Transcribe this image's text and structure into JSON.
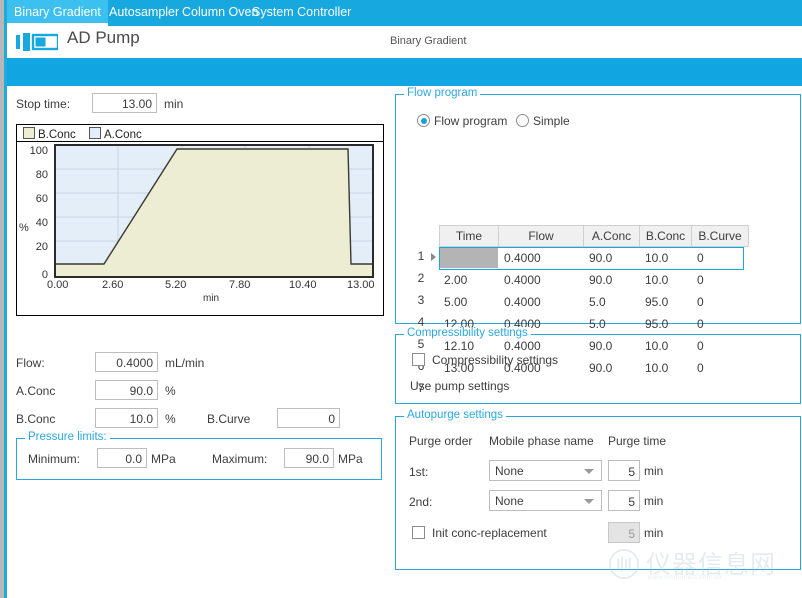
{
  "tabs": [
    {
      "label": "Binary Gradient",
      "active": true
    },
    {
      "label": "Autosampler",
      "active": false
    },
    {
      "label": "Column Oven",
      "active": false
    },
    {
      "label": "System Controller",
      "active": false
    }
  ],
  "header": {
    "title": "AD Pump",
    "mode": "Binary Gradient",
    "icon": "pump-icon"
  },
  "left": {
    "stop_time_label": "Stop time:",
    "stop_time_value": "13.00",
    "stop_time_unit": "min",
    "collapse_icon": "chevron-double-up-icon",
    "flow_label": "Flow:",
    "flow_value": "0.4000",
    "flow_unit": "mL/min",
    "aconc_label": "A.Conc",
    "aconc_value": "90.0",
    "aconc_unit": "%",
    "bconc_label": "B.Conc",
    "bconc_value": "10.0",
    "bconc_unit": "%",
    "bcurve_label": "B.Curve",
    "bcurve_value": "0",
    "pressure": {
      "group_title": "Pressure limits:",
      "min_label": "Minimum:",
      "min_value": "0.0",
      "min_unit": "MPa",
      "max_label": "Maximum:",
      "max_value": "90.0",
      "max_unit": "MPa"
    }
  },
  "chart_data": {
    "type": "area",
    "title": "",
    "xlabel": "min",
    "ylabel": "%",
    "xlim": [
      0,
      13
    ],
    "ylim": [
      0,
      105
    ],
    "xticks": [
      "0.00",
      "2.60",
      "5.20",
      "7.80",
      "10.40",
      "13.00"
    ],
    "xtick_values": [
      0,
      2.6,
      5.2,
      7.8,
      10.4,
      13.0
    ],
    "yticks": [
      "0",
      "20",
      "40",
      "60",
      "80",
      "100"
    ],
    "ytick_values": [
      0,
      20,
      40,
      60,
      80,
      100
    ],
    "grid": true,
    "legend_position": "top-left",
    "series": [
      {
        "name": "B.Conc",
        "color": "#ecedd2",
        "x": [
          0.0,
          2.0,
          5.0,
          12.0,
          12.1,
          13.0
        ],
        "values": [
          10.0,
          10.0,
          95.0,
          95.0,
          10.0,
          10.0
        ]
      },
      {
        "name": "A.Conc",
        "color": "#e4eef8",
        "x": [
          0.0,
          2.0,
          5.0,
          12.0,
          12.1,
          13.0
        ],
        "values": [
          90.0,
          90.0,
          5.0,
          5.0,
          90.0,
          90.0
        ]
      }
    ]
  },
  "flow_program": {
    "group_title": "Flow program",
    "radio_program": "Flow program",
    "radio_simple": "Simple",
    "selected_mode": "Flow program",
    "columns": [
      "Time",
      "Flow",
      "A.Conc",
      "B.Conc",
      "B.Curve"
    ],
    "rows": [
      {
        "n": "1",
        "Time": "",
        "Flow": "0.4000",
        "A.Conc": "90.0",
        "B.Conc": "10.0",
        "B.Curve": "0",
        "selected": true
      },
      {
        "n": "2",
        "Time": "2.00",
        "Flow": "0.4000",
        "A.Conc": "90.0",
        "B.Conc": "10.0",
        "B.Curve": "0",
        "selected": false
      },
      {
        "n": "3",
        "Time": "5.00",
        "Flow": "0.4000",
        "A.Conc": "5.0",
        "B.Conc": "95.0",
        "B.Curve": "0",
        "selected": false
      },
      {
        "n": "4",
        "Time": "12.00",
        "Flow": "0.4000",
        "A.Conc": "5.0",
        "B.Conc": "95.0",
        "B.Curve": "0",
        "selected": false
      },
      {
        "n": "5",
        "Time": "12.10",
        "Flow": "0.4000",
        "A.Conc": "90.0",
        "B.Conc": "10.0",
        "B.Curve": "0",
        "selected": false
      },
      {
        "n": "6",
        "Time": "13.00",
        "Flow": "0.4000",
        "A.Conc": "90.0",
        "B.Conc": "10.0",
        "B.Curve": "0",
        "selected": false
      },
      {
        "n": "7",
        "Time": "",
        "Flow": "",
        "A.Conc": "",
        "B.Conc": "",
        "B.Curve": "",
        "selected": false
      }
    ]
  },
  "compressibility": {
    "group_title": "Compressibility settings",
    "checkbox_label": "Compressibility settings",
    "checked": false,
    "note": "Use pump settings"
  },
  "autopurge": {
    "group_title": "Autopurge settings",
    "col_order": "Purge order",
    "col_phase": "Mobile phase name",
    "col_time": "Purge time",
    "unit": "min",
    "rows": [
      {
        "order": "1st:",
        "phase": "None",
        "time": "5"
      },
      {
        "order": "2nd:",
        "phase": "None",
        "time": "5"
      }
    ],
    "init_conc_label": "Init conc-replacement",
    "init_conc_checked": false,
    "init_conc_time": "5"
  },
  "watermark": {
    "text": "仪器信息网",
    "sub": "www.instrument.com.cn"
  },
  "colors": {
    "accent": "#17a8e0",
    "tab_active": "#3bc0f0",
    "group_border": "#2aa8dd",
    "b_conc_fill": "#ecedd2",
    "a_conc_fill": "#e4eef8"
  }
}
